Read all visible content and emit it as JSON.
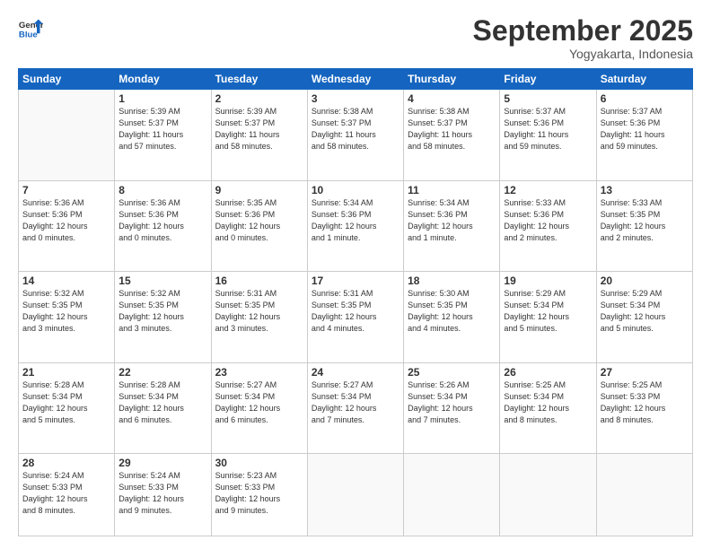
{
  "logo": {
    "general": "General",
    "blue": "Blue"
  },
  "header": {
    "title": "September 2025",
    "subtitle": "Yogyakarta, Indonesia"
  },
  "days_of_week": [
    "Sunday",
    "Monday",
    "Tuesday",
    "Wednesday",
    "Thursday",
    "Friday",
    "Saturday"
  ],
  "weeks": [
    [
      {
        "day": "",
        "info": ""
      },
      {
        "day": "1",
        "info": "Sunrise: 5:39 AM\nSunset: 5:37 PM\nDaylight: 11 hours\nand 57 minutes."
      },
      {
        "day": "2",
        "info": "Sunrise: 5:39 AM\nSunset: 5:37 PM\nDaylight: 11 hours\nand 58 minutes."
      },
      {
        "day": "3",
        "info": "Sunrise: 5:38 AM\nSunset: 5:37 PM\nDaylight: 11 hours\nand 58 minutes."
      },
      {
        "day": "4",
        "info": "Sunrise: 5:38 AM\nSunset: 5:37 PM\nDaylight: 11 hours\nand 58 minutes."
      },
      {
        "day": "5",
        "info": "Sunrise: 5:37 AM\nSunset: 5:36 PM\nDaylight: 11 hours\nand 59 minutes."
      },
      {
        "day": "6",
        "info": "Sunrise: 5:37 AM\nSunset: 5:36 PM\nDaylight: 11 hours\nand 59 minutes."
      }
    ],
    [
      {
        "day": "7",
        "info": "Sunrise: 5:36 AM\nSunset: 5:36 PM\nDaylight: 12 hours\nand 0 minutes."
      },
      {
        "day": "8",
        "info": "Sunrise: 5:36 AM\nSunset: 5:36 PM\nDaylight: 12 hours\nand 0 minutes."
      },
      {
        "day": "9",
        "info": "Sunrise: 5:35 AM\nSunset: 5:36 PM\nDaylight: 12 hours\nand 0 minutes."
      },
      {
        "day": "10",
        "info": "Sunrise: 5:34 AM\nSunset: 5:36 PM\nDaylight: 12 hours\nand 1 minute."
      },
      {
        "day": "11",
        "info": "Sunrise: 5:34 AM\nSunset: 5:36 PM\nDaylight: 12 hours\nand 1 minute."
      },
      {
        "day": "12",
        "info": "Sunrise: 5:33 AM\nSunset: 5:36 PM\nDaylight: 12 hours\nand 2 minutes."
      },
      {
        "day": "13",
        "info": "Sunrise: 5:33 AM\nSunset: 5:35 PM\nDaylight: 12 hours\nand 2 minutes."
      }
    ],
    [
      {
        "day": "14",
        "info": "Sunrise: 5:32 AM\nSunset: 5:35 PM\nDaylight: 12 hours\nand 3 minutes."
      },
      {
        "day": "15",
        "info": "Sunrise: 5:32 AM\nSunset: 5:35 PM\nDaylight: 12 hours\nand 3 minutes."
      },
      {
        "day": "16",
        "info": "Sunrise: 5:31 AM\nSunset: 5:35 PM\nDaylight: 12 hours\nand 3 minutes."
      },
      {
        "day": "17",
        "info": "Sunrise: 5:31 AM\nSunset: 5:35 PM\nDaylight: 12 hours\nand 4 minutes."
      },
      {
        "day": "18",
        "info": "Sunrise: 5:30 AM\nSunset: 5:35 PM\nDaylight: 12 hours\nand 4 minutes."
      },
      {
        "day": "19",
        "info": "Sunrise: 5:29 AM\nSunset: 5:34 PM\nDaylight: 12 hours\nand 5 minutes."
      },
      {
        "day": "20",
        "info": "Sunrise: 5:29 AM\nSunset: 5:34 PM\nDaylight: 12 hours\nand 5 minutes."
      }
    ],
    [
      {
        "day": "21",
        "info": "Sunrise: 5:28 AM\nSunset: 5:34 PM\nDaylight: 12 hours\nand 5 minutes."
      },
      {
        "day": "22",
        "info": "Sunrise: 5:28 AM\nSunset: 5:34 PM\nDaylight: 12 hours\nand 6 minutes."
      },
      {
        "day": "23",
        "info": "Sunrise: 5:27 AM\nSunset: 5:34 PM\nDaylight: 12 hours\nand 6 minutes."
      },
      {
        "day": "24",
        "info": "Sunrise: 5:27 AM\nSunset: 5:34 PM\nDaylight: 12 hours\nand 7 minutes."
      },
      {
        "day": "25",
        "info": "Sunrise: 5:26 AM\nSunset: 5:34 PM\nDaylight: 12 hours\nand 7 minutes."
      },
      {
        "day": "26",
        "info": "Sunrise: 5:25 AM\nSunset: 5:34 PM\nDaylight: 12 hours\nand 8 minutes."
      },
      {
        "day": "27",
        "info": "Sunrise: 5:25 AM\nSunset: 5:33 PM\nDaylight: 12 hours\nand 8 minutes."
      }
    ],
    [
      {
        "day": "28",
        "info": "Sunrise: 5:24 AM\nSunset: 5:33 PM\nDaylight: 12 hours\nand 8 minutes."
      },
      {
        "day": "29",
        "info": "Sunrise: 5:24 AM\nSunset: 5:33 PM\nDaylight: 12 hours\nand 9 minutes."
      },
      {
        "day": "30",
        "info": "Sunrise: 5:23 AM\nSunset: 5:33 PM\nDaylight: 12 hours\nand 9 minutes."
      },
      {
        "day": "",
        "info": ""
      },
      {
        "day": "",
        "info": ""
      },
      {
        "day": "",
        "info": ""
      },
      {
        "day": "",
        "info": ""
      }
    ]
  ]
}
